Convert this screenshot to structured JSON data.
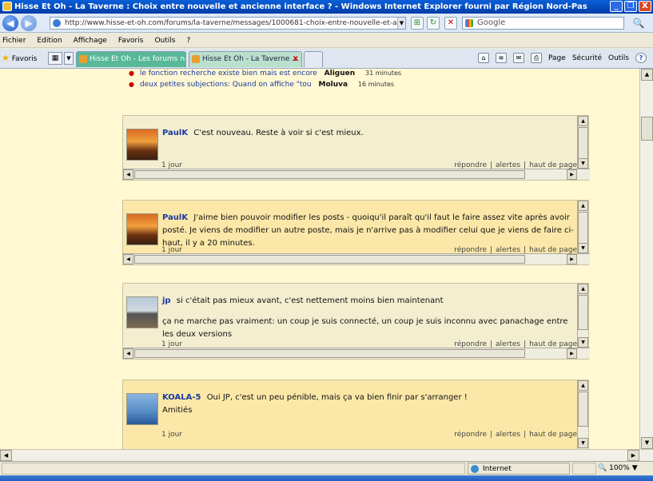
{
  "window": {
    "title": "Hisse Et Oh - La Taverne : Choix entre nouvelle et ancienne interface ? - Windows Internet Explorer fourni par Région Nord-Pas",
    "minimize": "_",
    "maximize": "❐",
    "close": "X"
  },
  "nav": {
    "back": "◀",
    "forward": "▶",
    "address": "http://www.hisse-et-oh.com/forums/la-taverne/messages/1000681-choix-entre-nouvelle-et-ancienne-interface",
    "search_placeholder": "Google",
    "search_button": "🔍"
  },
  "menu": [
    "Fichier",
    "Edition",
    "Affichage",
    "Favoris",
    "Outils",
    "?"
  ],
  "tabs": {
    "favorites_label": "Favoris",
    "items": [
      {
        "label": "Hisse Et Oh - Les forums naut..."
      },
      {
        "label": "Hisse Et Oh - La Taverne ..."
      }
    ],
    "close": "x"
  },
  "command_bar": {
    "page": "Page",
    "security": "Sécurité",
    "tools": "Outils",
    "help": "?"
  },
  "recent": [
    {
      "text": "le fonction recherche existe bien mais est encore",
      "author": "Aliguen",
      "time": "31 minutes"
    },
    {
      "text": "deux petites subjections: Quand on affiche \"tou",
      "author": "Moluva",
      "time": "16 minutes"
    }
  ],
  "posts": [
    {
      "author": "PaulK",
      "text": "C'est nouveau. Reste à voir si c'est mieux.",
      "when": "1 jour"
    },
    {
      "author": "PaulK",
      "text": "J'aime bien pouvoir modifier les posts - quoiqu'il paraît qu'il faut le faire assez vite après avoir posté. Je viens de modifier un autre poste, mais je n'arrive pas à modifier celui que je viens de faire ci-haut, il y a 20 minutes.",
      "when": "1 jour"
    },
    {
      "author": "jp",
      "text": "si c'était pas mieux avant, c'est nettement moins bien maintenant",
      "text2": "ça ne marche pas vraiment: un coup je suis connecté, un coup je suis inconnu avec panachage entre les deux versions",
      "when": "1 jour"
    },
    {
      "author": "KOALA-5",
      "text": "Oui JP, c'est un peu pénible, mais ça va bien finir par s'arranger !",
      "text2": "Amitiés",
      "when": "1 jour"
    }
  ],
  "post_links": {
    "reply": "répondre",
    "sep": "|",
    "alert": "alertes",
    "top": "haut de page"
  },
  "status": {
    "zone": "Internet",
    "zoom": "100%"
  }
}
